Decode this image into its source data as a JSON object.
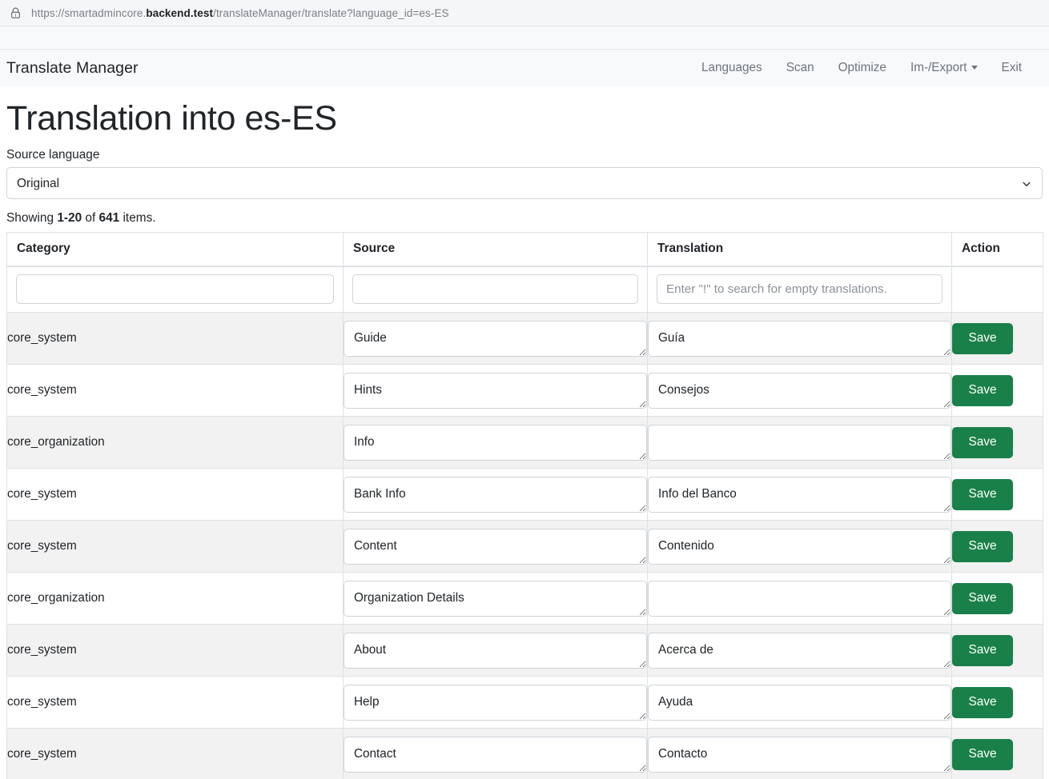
{
  "browser": {
    "lock_icon": "lock-warning-icon",
    "url_prefix": "https://smartadmincore.",
    "url_bold": "backend.test",
    "url_suffix": "/translateManager/translate?language_id=es-ES"
  },
  "navbar": {
    "brand": "Translate Manager",
    "links": [
      {
        "label": "Languages",
        "name": "nav-languages"
      },
      {
        "label": "Scan",
        "name": "nav-scan"
      },
      {
        "label": "Optimize",
        "name": "nav-optimize"
      },
      {
        "label": "Im-/Export",
        "name": "nav-import-export",
        "dropdown": true
      },
      {
        "label": "Exit",
        "name": "nav-exit"
      }
    ]
  },
  "page": {
    "title": "Translation into es-ES",
    "source_language_label": "Source language",
    "source_language_value": "Original",
    "showing_prefix": "Showing ",
    "showing_range": "1-20",
    "showing_middle": " of ",
    "showing_total": "641",
    "showing_suffix": " items."
  },
  "table": {
    "headers": {
      "category": "Category",
      "source": "Source",
      "translation": "Translation",
      "action": "Action"
    },
    "filters": {
      "category_value": "",
      "category_placeholder": "",
      "source_value": "",
      "source_placeholder": "",
      "translation_value": "",
      "translation_placeholder": "Enter \"!\" to search for empty translations."
    },
    "save_label": "Save",
    "rows": [
      {
        "category": "core_system",
        "source": "Guide",
        "translation": "Guía"
      },
      {
        "category": "core_system",
        "source": "Hints",
        "translation": "Consejos"
      },
      {
        "category": "core_organization",
        "source": "Info",
        "translation": ""
      },
      {
        "category": "core_system",
        "source": "Bank Info",
        "translation": "Info del Banco"
      },
      {
        "category": "core_system",
        "source": "Content",
        "translation": "Contenido"
      },
      {
        "category": "core_organization",
        "source": "Organization Details",
        "translation": ""
      },
      {
        "category": "core_system",
        "source": "About",
        "translation": "Acerca de"
      },
      {
        "category": "core_system",
        "source": "Help",
        "translation": "Ayuda"
      },
      {
        "category": "core_system",
        "source": "Contact",
        "translation": "Contacto"
      }
    ]
  },
  "colors": {
    "save_green": "#1a8049",
    "navbar_bg": "#f8f9fa",
    "stripe": "#f2f2f2",
    "border": "#dee2e6"
  }
}
